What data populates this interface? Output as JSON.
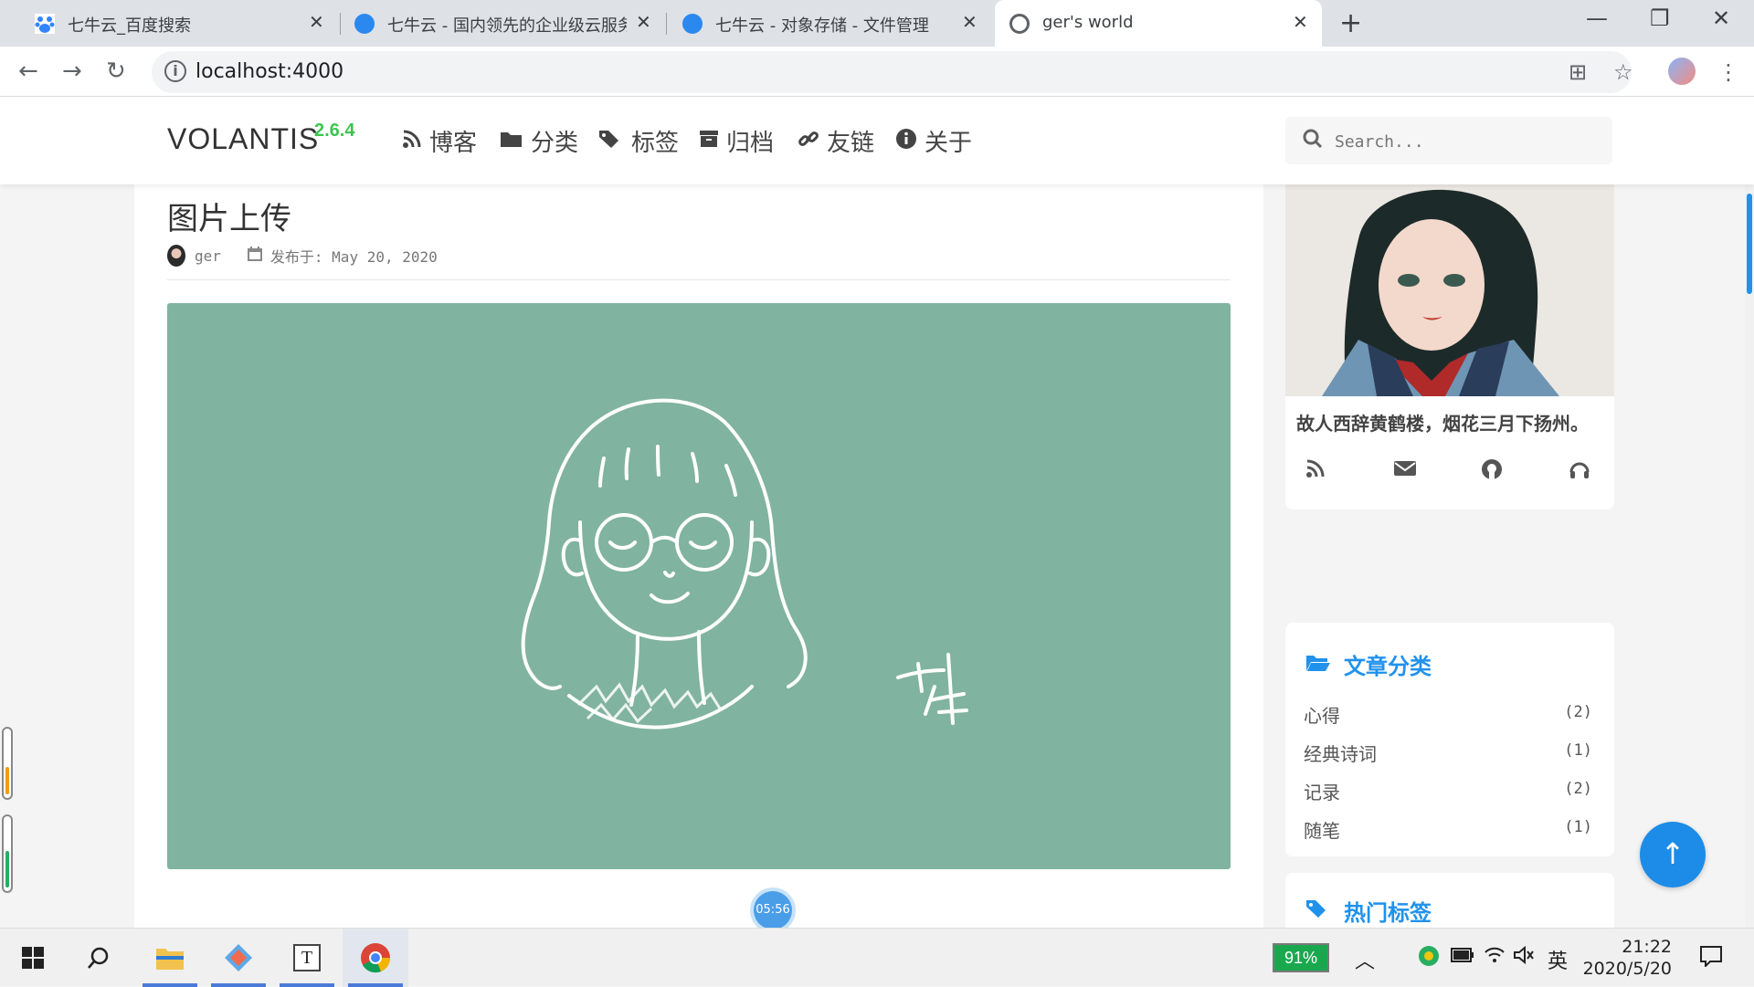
{
  "browser": {
    "tabs": [
      {
        "title": "七牛云_百度搜索",
        "active": false
      },
      {
        "title": "七牛云 - 国内领先的企业级云服务",
        "active": false
      },
      {
        "title": "七牛云 - 对象存储 - 文件管理",
        "active": false
      },
      {
        "title": "ger's world",
        "active": true
      }
    ],
    "url": "localhost:4000"
  },
  "site": {
    "brand": "VOLANTIS",
    "version": "2.6.4",
    "nav": [
      {
        "label": "博客",
        "icon": "rss-icon"
      },
      {
        "label": "分类",
        "icon": "folder-icon"
      },
      {
        "label": "标签",
        "icon": "tags-icon"
      },
      {
        "label": "归档",
        "icon": "archive-icon"
      },
      {
        "label": "友链",
        "icon": "link-icon"
      },
      {
        "label": "关于",
        "icon": "info-icon"
      }
    ],
    "search_placeholder": "Search..."
  },
  "post": {
    "title": "图片上传",
    "author": "ger",
    "published": "发布于: May 20, 2020"
  },
  "timer": "05:56",
  "sidebar": {
    "motto": "故人西辞黄鹤楼，烟花三月下扬州。",
    "categories_title": "文章分类",
    "categories": [
      {
        "name": "心得",
        "count": "(2)"
      },
      {
        "name": "经典诗词",
        "count": "(1)"
      },
      {
        "name": "记录",
        "count": "(2)"
      },
      {
        "name": "随笔",
        "count": "(1)"
      }
    ],
    "tags_title": "热门标签"
  },
  "taskbar": {
    "battery": "91%",
    "ime": "英",
    "time": "21:22",
    "date": "2020/5/20"
  },
  "colors": {
    "accent": "#2092ec",
    "version_green": "#3dc550",
    "image_bg": "#80b3a0"
  }
}
